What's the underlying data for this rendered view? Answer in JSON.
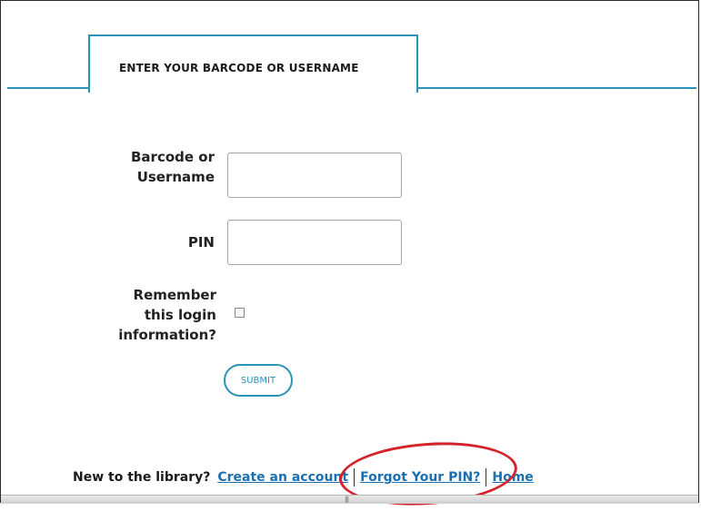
{
  "form": {
    "tab_title": "ENTER YOUR BARCODE OR USERNAME",
    "barcode_label_line1": "Barcode or",
    "barcode_label_line2": "Username",
    "barcode_value": "",
    "pin_label": "PIN",
    "pin_value": "",
    "remember_line1": "Remember",
    "remember_line2": "this login",
    "remember_line3": "information?",
    "remember_checked": false,
    "submit_label": "SUBMIT"
  },
  "footer": {
    "prompt": "New to the library?",
    "create_account": "Create an account",
    "forgot_pin": "Forgot Your PIN?",
    "home": "Home"
  },
  "status_bar": {
    "grip": "|||"
  },
  "colors": {
    "accent": "#2b93b8",
    "link": "#1a6fb0",
    "annotation": "#d4232b"
  }
}
